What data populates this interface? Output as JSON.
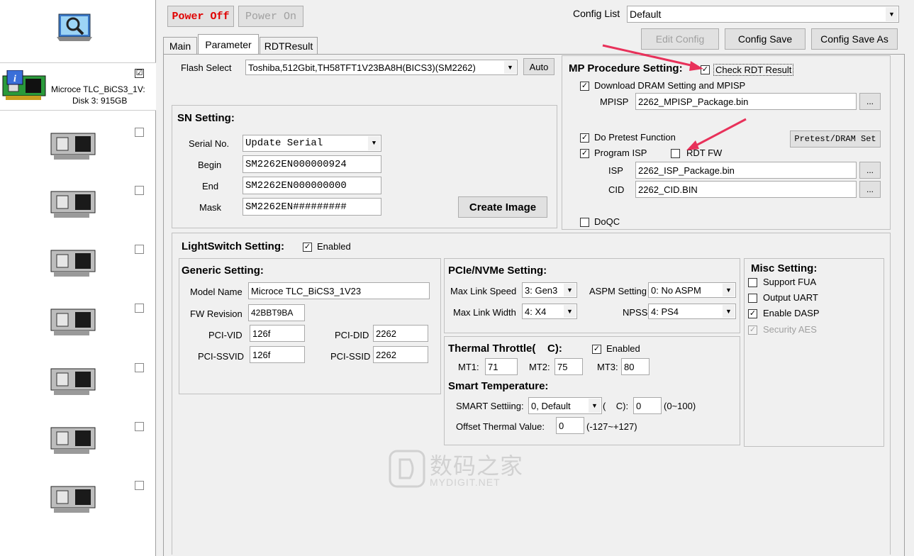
{
  "toolbar": {
    "power_off": "Power Off",
    "power_on": "Power On",
    "config_list_label": "Config List",
    "config_list_value": "Default",
    "edit_config": "Edit Config",
    "config_save": "Config Save",
    "config_save_as": "Config Save As"
  },
  "tabs": [
    "Main",
    "Parameter",
    "RDTResult"
  ],
  "sidebar": {
    "device_name": "Microce TLC_BiCS3_1V:",
    "device_disk": "Disk 3:  915GB",
    "device_checked": "☑"
  },
  "flash": {
    "label": "Flash Select",
    "value": "Toshiba,512Gbit,TH58TFT1V23BA8H(BICS3)(SM2262)",
    "auto": "Auto"
  },
  "sn": {
    "title": "SN Setting:",
    "serial_label": "Serial No.",
    "serial_value": "Update Serial",
    "begin_label": "Begin",
    "begin_value": "SM2262EN000000924",
    "end_label": "End",
    "end_value": "SM2262EN000000000",
    "mask_label": "Mask",
    "mask_value": "SM2262EN#########",
    "create_image": "Create Image"
  },
  "mp": {
    "title": "MP Procedure Setting:",
    "check_rdt": "Check RDT Result",
    "download_dram": "Download DRAM Setting and MPISP",
    "mpisp_label": "MPISP",
    "mpisp_value": "2262_MPISP_Package.bin",
    "do_pretest": "Do Pretest Function",
    "pretest_btn": "Pretest/DRAM Set",
    "program_isp": "Program ISP",
    "rdt_fw": "RDT FW",
    "isp_label": "ISP",
    "isp_value": "2262_ISP_Package.bin",
    "cid_label": "CID",
    "cid_value": "2262_CID.BIN",
    "doqc": "DoQC",
    "browse": "...",
    "browse2": "..."
  },
  "lightswitch": {
    "title": "LightSwitch Setting:",
    "enabled": "Enabled"
  },
  "generic": {
    "title": "Generic Setting:",
    "model_label": "Model Name",
    "model_value": "Microce TLC_BiCS3_1V23",
    "fw_label": "FW Revision",
    "fw_value": "42BBT9BA",
    "pcivid_label": "PCI-VID",
    "pcivid_value": "126f",
    "pcidid_label": "PCI-DID",
    "pcidid_value": "2262",
    "pcissvid_label": "PCI-SSVID",
    "pcissvid_value": "126f",
    "pcissid_label": "PCI-SSID",
    "pcissid_value": "2262"
  },
  "pcie": {
    "title": "PCIe/NVMe Setting:",
    "max_speed_label": "Max Link Speed",
    "max_speed_value": "3: Gen3",
    "aspm_label": "ASPM Setting",
    "aspm_value": "0: No ASPM",
    "max_width_label": "Max Link Width",
    "max_width_value": "4: X4",
    "npss_label": "NPSS",
    "npss_value": "4: PS4"
  },
  "thermal": {
    "title": "Thermal Throttle(    C):",
    "enabled": "Enabled",
    "mt1_label": "MT1:",
    "mt1_value": "71",
    "mt2_label": "MT2:",
    "mt2_value": "75",
    "mt3_label": "MT3:",
    "mt3_value": "80",
    "smart_title": "Smart Temperature:",
    "smart_label": "SMART Settiing:",
    "smart_value": "0, Default",
    "c_label": "(    C):",
    "c_value": "0",
    "c_range": "(0~100)",
    "offset_label": "Offset Thermal Value:",
    "offset_value": "0",
    "offset_range": "(-127~+127)"
  },
  "misc": {
    "title": "Misc Setting:",
    "support_fua": "Support FUA",
    "output_uart": "Output UART",
    "enable_dasp": "Enable DASP",
    "security_aes": "Security AES"
  },
  "watermark": {
    "cn": "数码之家",
    "en": "MYDIGIT.NET"
  },
  "colors": {
    "arrow": "#e8315a",
    "power_off": "#e00000"
  }
}
